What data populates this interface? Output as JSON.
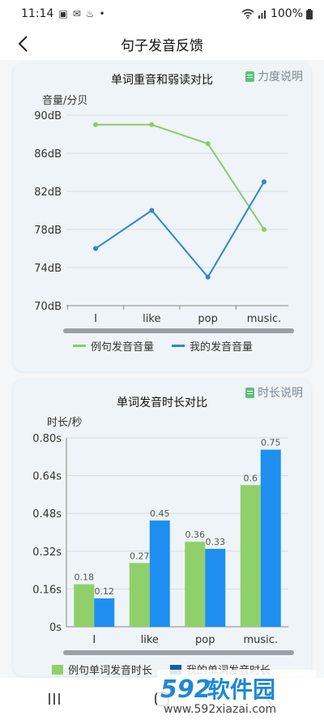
{
  "status": {
    "time": "11:14",
    "battery": "100%"
  },
  "header": {
    "title": "句子发音反馈"
  },
  "card1": {
    "help_label": "力度说明"
  },
  "card2": {
    "help_label": "时长说明"
  },
  "watermark": {
    "text": "592软件园",
    "url": "www.592xiazai.com"
  },
  "colors": {
    "green": "#8ec96a",
    "blue": "#2f86d0",
    "bar_green": "#8fd06b",
    "bar_blue": "#1e8ff0"
  },
  "chart_data": [
    {
      "type": "line",
      "title": "单词重音和弱读对比",
      "ylabel": "音量/分贝",
      "categories": [
        "I",
        "like",
        "pop",
        "music."
      ],
      "yticks": [
        "70dB",
        "74dB",
        "78dB",
        "82dB",
        "86dB",
        "90dB"
      ],
      "ylim": [
        70,
        90
      ],
      "series": [
        {
          "name": "例句发音音量",
          "values": [
            89,
            89,
            87,
            78
          ]
        },
        {
          "name": "我的发音音量",
          "values": [
            76,
            80,
            73,
            83
          ]
        }
      ],
      "legend": "bottom",
      "grid": true
    },
    {
      "type": "bar",
      "title": "单词发音时长对比",
      "ylabel": "时长/秒",
      "categories": [
        "I",
        "like",
        "pop",
        "music."
      ],
      "yticks": [
        "0s",
        "0.16s",
        "0.32s",
        "0.48s",
        "0.64s",
        "0.80s"
      ],
      "ylim": [
        0,
        0.8
      ],
      "series": [
        {
          "name": "例句单词发音时长",
          "values": [
            0.18,
            0.27,
            0.36,
            0.6
          ],
          "labels": [
            "0.18",
            "0.27",
            "0.36",
            "0.6"
          ]
        },
        {
          "name": "我的单词发音时长",
          "values": [
            0.12,
            0.45,
            0.33,
            0.75
          ],
          "labels": [
            "0.12",
            "0.45",
            "0.33",
            "0.75"
          ]
        }
      ],
      "legend": "bottom",
      "grid": true
    }
  ]
}
